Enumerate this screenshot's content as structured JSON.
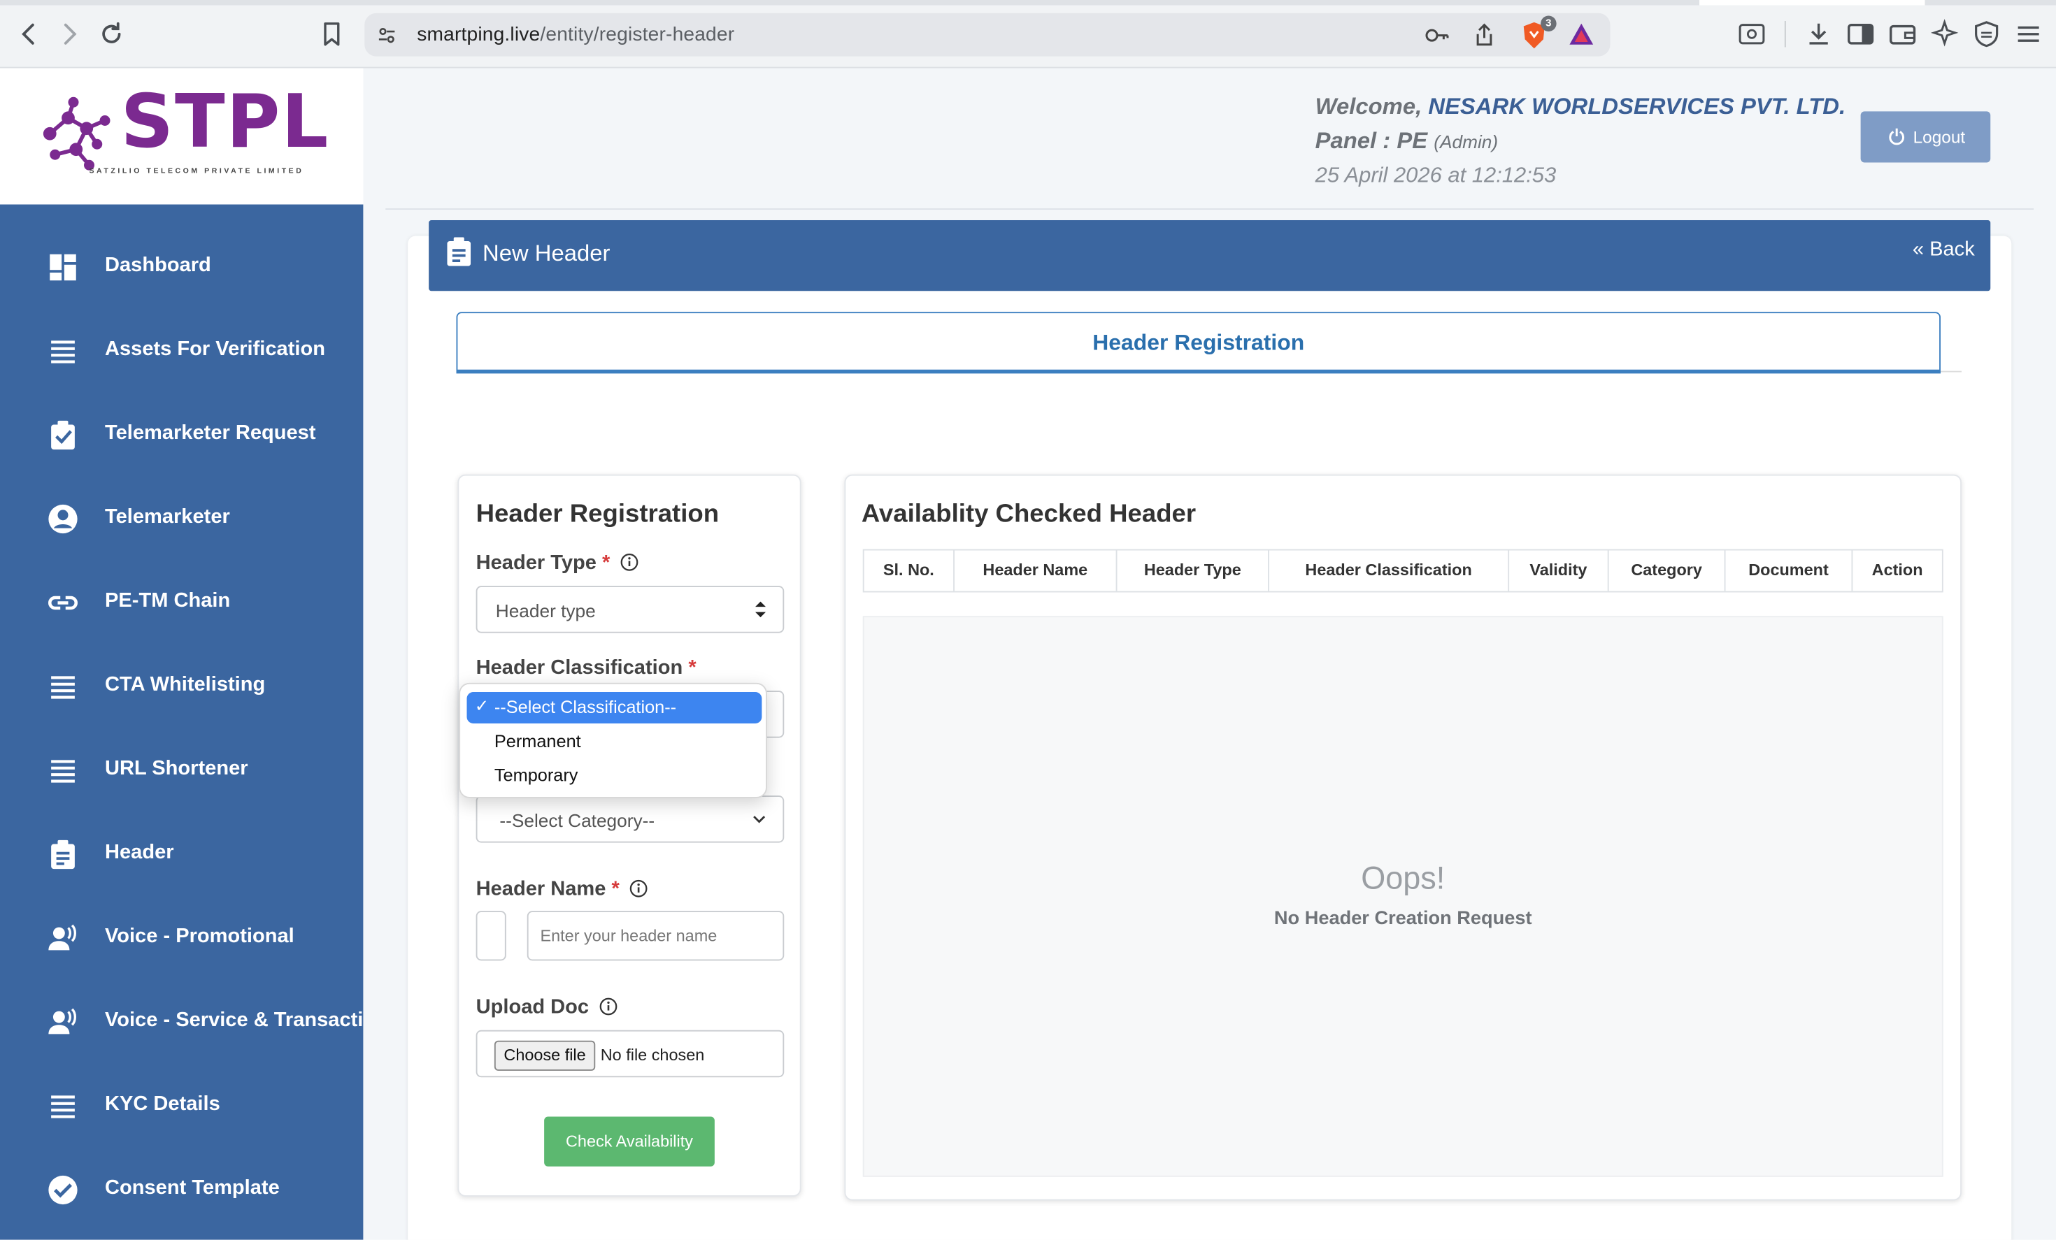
{
  "browser": {
    "url_host": "smartping.live",
    "url_path": "/entity/register-header",
    "shield_badge": "3"
  },
  "logo": {
    "text": "STPL",
    "subtitle": "SATZILIO TELECOM PRIVATE LIMITED"
  },
  "sidebar": {
    "items": [
      {
        "label": "Dashboard",
        "icon": "dashboard-icon"
      },
      {
        "label": "Assets For Verification",
        "icon": "list-icon"
      },
      {
        "label": "Telemarketer Request",
        "icon": "clipboard-check-icon"
      },
      {
        "label": "Telemarketer",
        "icon": "user-circle-icon"
      },
      {
        "label": "PE-TM Chain",
        "icon": "link-icon"
      },
      {
        "label": "CTA Whitelisting",
        "icon": "list-icon"
      },
      {
        "label": "URL Shortener",
        "icon": "list-icon"
      },
      {
        "label": "Header",
        "icon": "clipboard-icon"
      },
      {
        "label": "Voice - Promotional",
        "icon": "voice-icon"
      },
      {
        "label": "Voice - Service & Transactional",
        "icon": "voice-icon"
      },
      {
        "label": "KYC Details",
        "icon": "list-icon"
      },
      {
        "label": "Consent Template",
        "icon": "check-circle-icon"
      }
    ]
  },
  "header": {
    "welcome_prefix": "Welcome,",
    "company": "NESARK WORLDSERVICES PVT. LTD.",
    "panel_label": "Panel : PE",
    "panel_role": "(Admin)",
    "datetime": "25 April 2026 at 12:12:53",
    "logout_label": "Logout"
  },
  "card": {
    "title": "New Header",
    "back_label": "Back",
    "tab_label": "Header Registration"
  },
  "form": {
    "title": "Header Registration",
    "header_type_label": "Header Type",
    "header_type_value": "Header type",
    "classification_label": "Header Classification",
    "classification_options": [
      "--Select Classification--",
      "Permanent",
      "Temporary"
    ],
    "classification_selected": "--Select Classification--",
    "category_value": "--Select Category--",
    "header_name_label": "Header Name",
    "header_name_placeholder": "Enter your header name",
    "upload_label": "Upload Doc",
    "choose_file_label": "Choose file",
    "no_file_label": "No file chosen",
    "check_button": "Check Availability",
    "required_mark": "*"
  },
  "table": {
    "title": "Availablity Checked Header",
    "columns": [
      "Sl. No.",
      "Header Name",
      "Header Type",
      "Header Classification",
      "Validity",
      "Category",
      "Document",
      "Action"
    ],
    "empty_title": "Oops!",
    "empty_message": "No Header Creation Request"
  }
}
